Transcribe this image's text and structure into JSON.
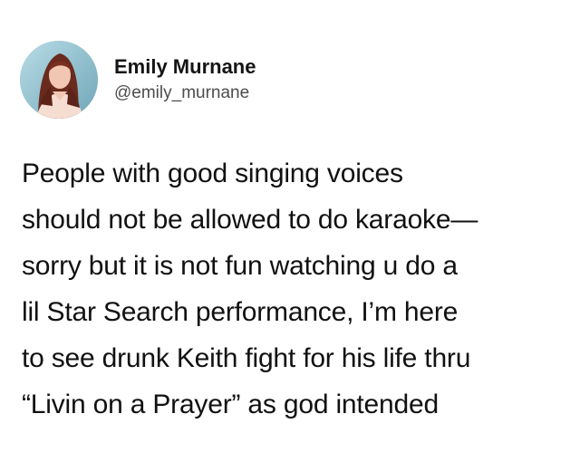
{
  "user": {
    "display_name": "Emily Murnane",
    "handle": "@emily_murnane",
    "avatar_icon": "profile-photo"
  },
  "tweet": {
    "lines": [
      "People with good singing voices",
      "should not be allowed to do karaoke—",
      "sorry but it is not fun watching u do a",
      "lil Star Search performance, I’m here",
      "to see drunk Keith fight for his life thru",
      "“Livin on a Prayer” as god intended"
    ]
  },
  "colors": {
    "background": "#ffffff",
    "text": "#111111",
    "handle": "#4d4d4d"
  }
}
